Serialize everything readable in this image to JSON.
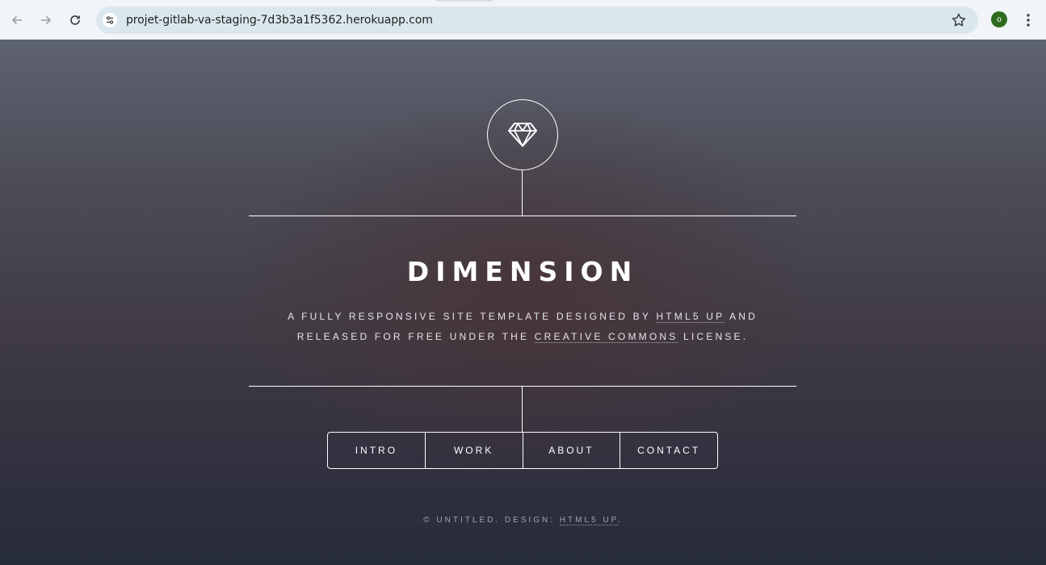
{
  "browser": {
    "url": "projet-gitlab-va-staging-7d3b3a1f5362.herokuapp.com",
    "profile_initial": "o",
    "icons": {
      "back": "arrow-left-icon",
      "forward": "arrow-right-icon",
      "reload": "reload-icon",
      "site_info": "tune-icon",
      "bookmark": "star-icon",
      "menu": "kebab-menu-icon"
    }
  },
  "page": {
    "logo_icon": "diamond-icon",
    "title": "DIMENSION",
    "description": {
      "part1": "A fully responsive site template designed by ",
      "link1": "HTML5 UP",
      "part2": " and released for free under the ",
      "link2": "Creative Commons",
      "part3": " license."
    },
    "nav": [
      "INTRO",
      "WORK",
      "ABOUT",
      "CONTACT"
    ],
    "footer": {
      "prefix": "© UNTITLED. DESIGN: ",
      "link": "HTML5 UP",
      "suffix": "."
    }
  }
}
